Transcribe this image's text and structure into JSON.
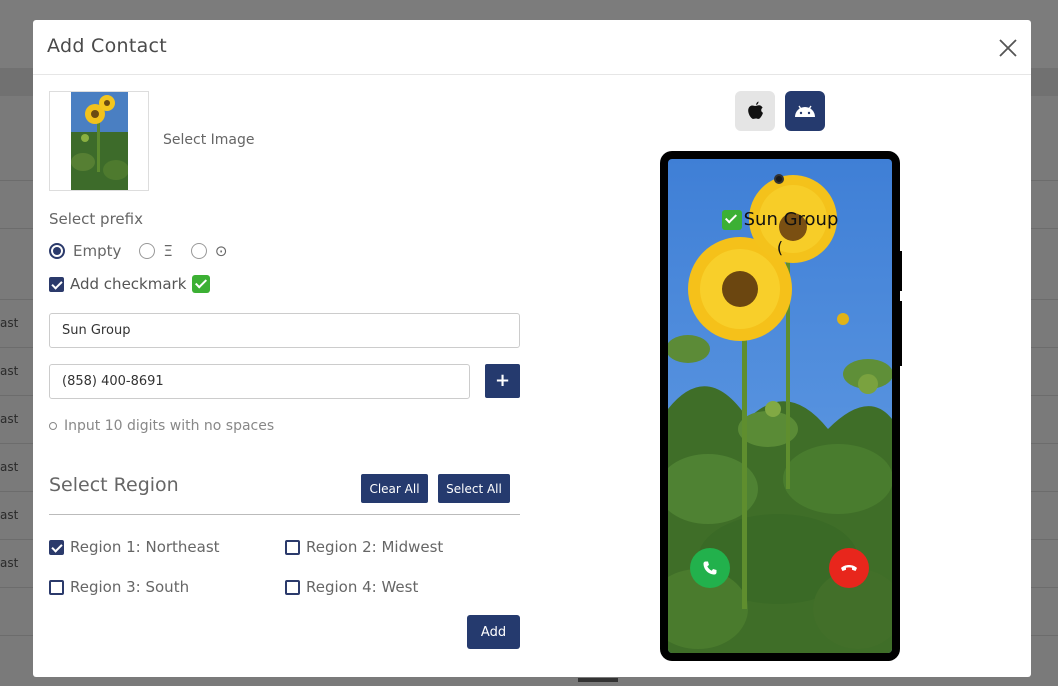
{
  "background": {
    "row_labels": [
      "ast",
      "ast",
      "ast",
      "ast",
      "ast",
      "ast"
    ]
  },
  "modal": {
    "title": "Add Contact",
    "close_icon": "close-icon"
  },
  "form": {
    "select_image_label": "Select Image",
    "prefix_label": "Select prefix",
    "prefix_options": [
      {
        "label": "Empty",
        "checked": true
      },
      {
        "label": "Ξ",
        "checked": false
      },
      {
        "label": "⊙",
        "checked": false
      }
    ],
    "add_checkmark_label": "Add checkmark",
    "add_checkmark_checked": true,
    "name_value": "Sun Group",
    "phone_value": "(858) 400-8691",
    "plus_label": "+",
    "hint": "Input 10 digits with no spaces"
  },
  "regions": {
    "title": "Select Region",
    "clear_all_label": "Clear All",
    "select_all_label": "Select All",
    "items": [
      {
        "label": "Region 1: Northeast",
        "checked": true
      },
      {
        "label": "Region 2: Midwest",
        "checked": false
      },
      {
        "label": "Region 3: South",
        "checked": false
      },
      {
        "label": "Region 4: West",
        "checked": false
      }
    ],
    "add_label": "Add"
  },
  "preview": {
    "os_buttons": [
      {
        "icon": "apple-icon",
        "active": false
      },
      {
        "icon": "android-icon",
        "active": true
      }
    ],
    "caller_name": "Sun Group",
    "caller_phone": "(",
    "accept_icon": "phone-accept-icon",
    "decline_icon": "phone-decline-icon",
    "colors": {
      "accept": "#22b14c",
      "decline": "#e8261c",
      "primary": "#253a6e"
    }
  }
}
